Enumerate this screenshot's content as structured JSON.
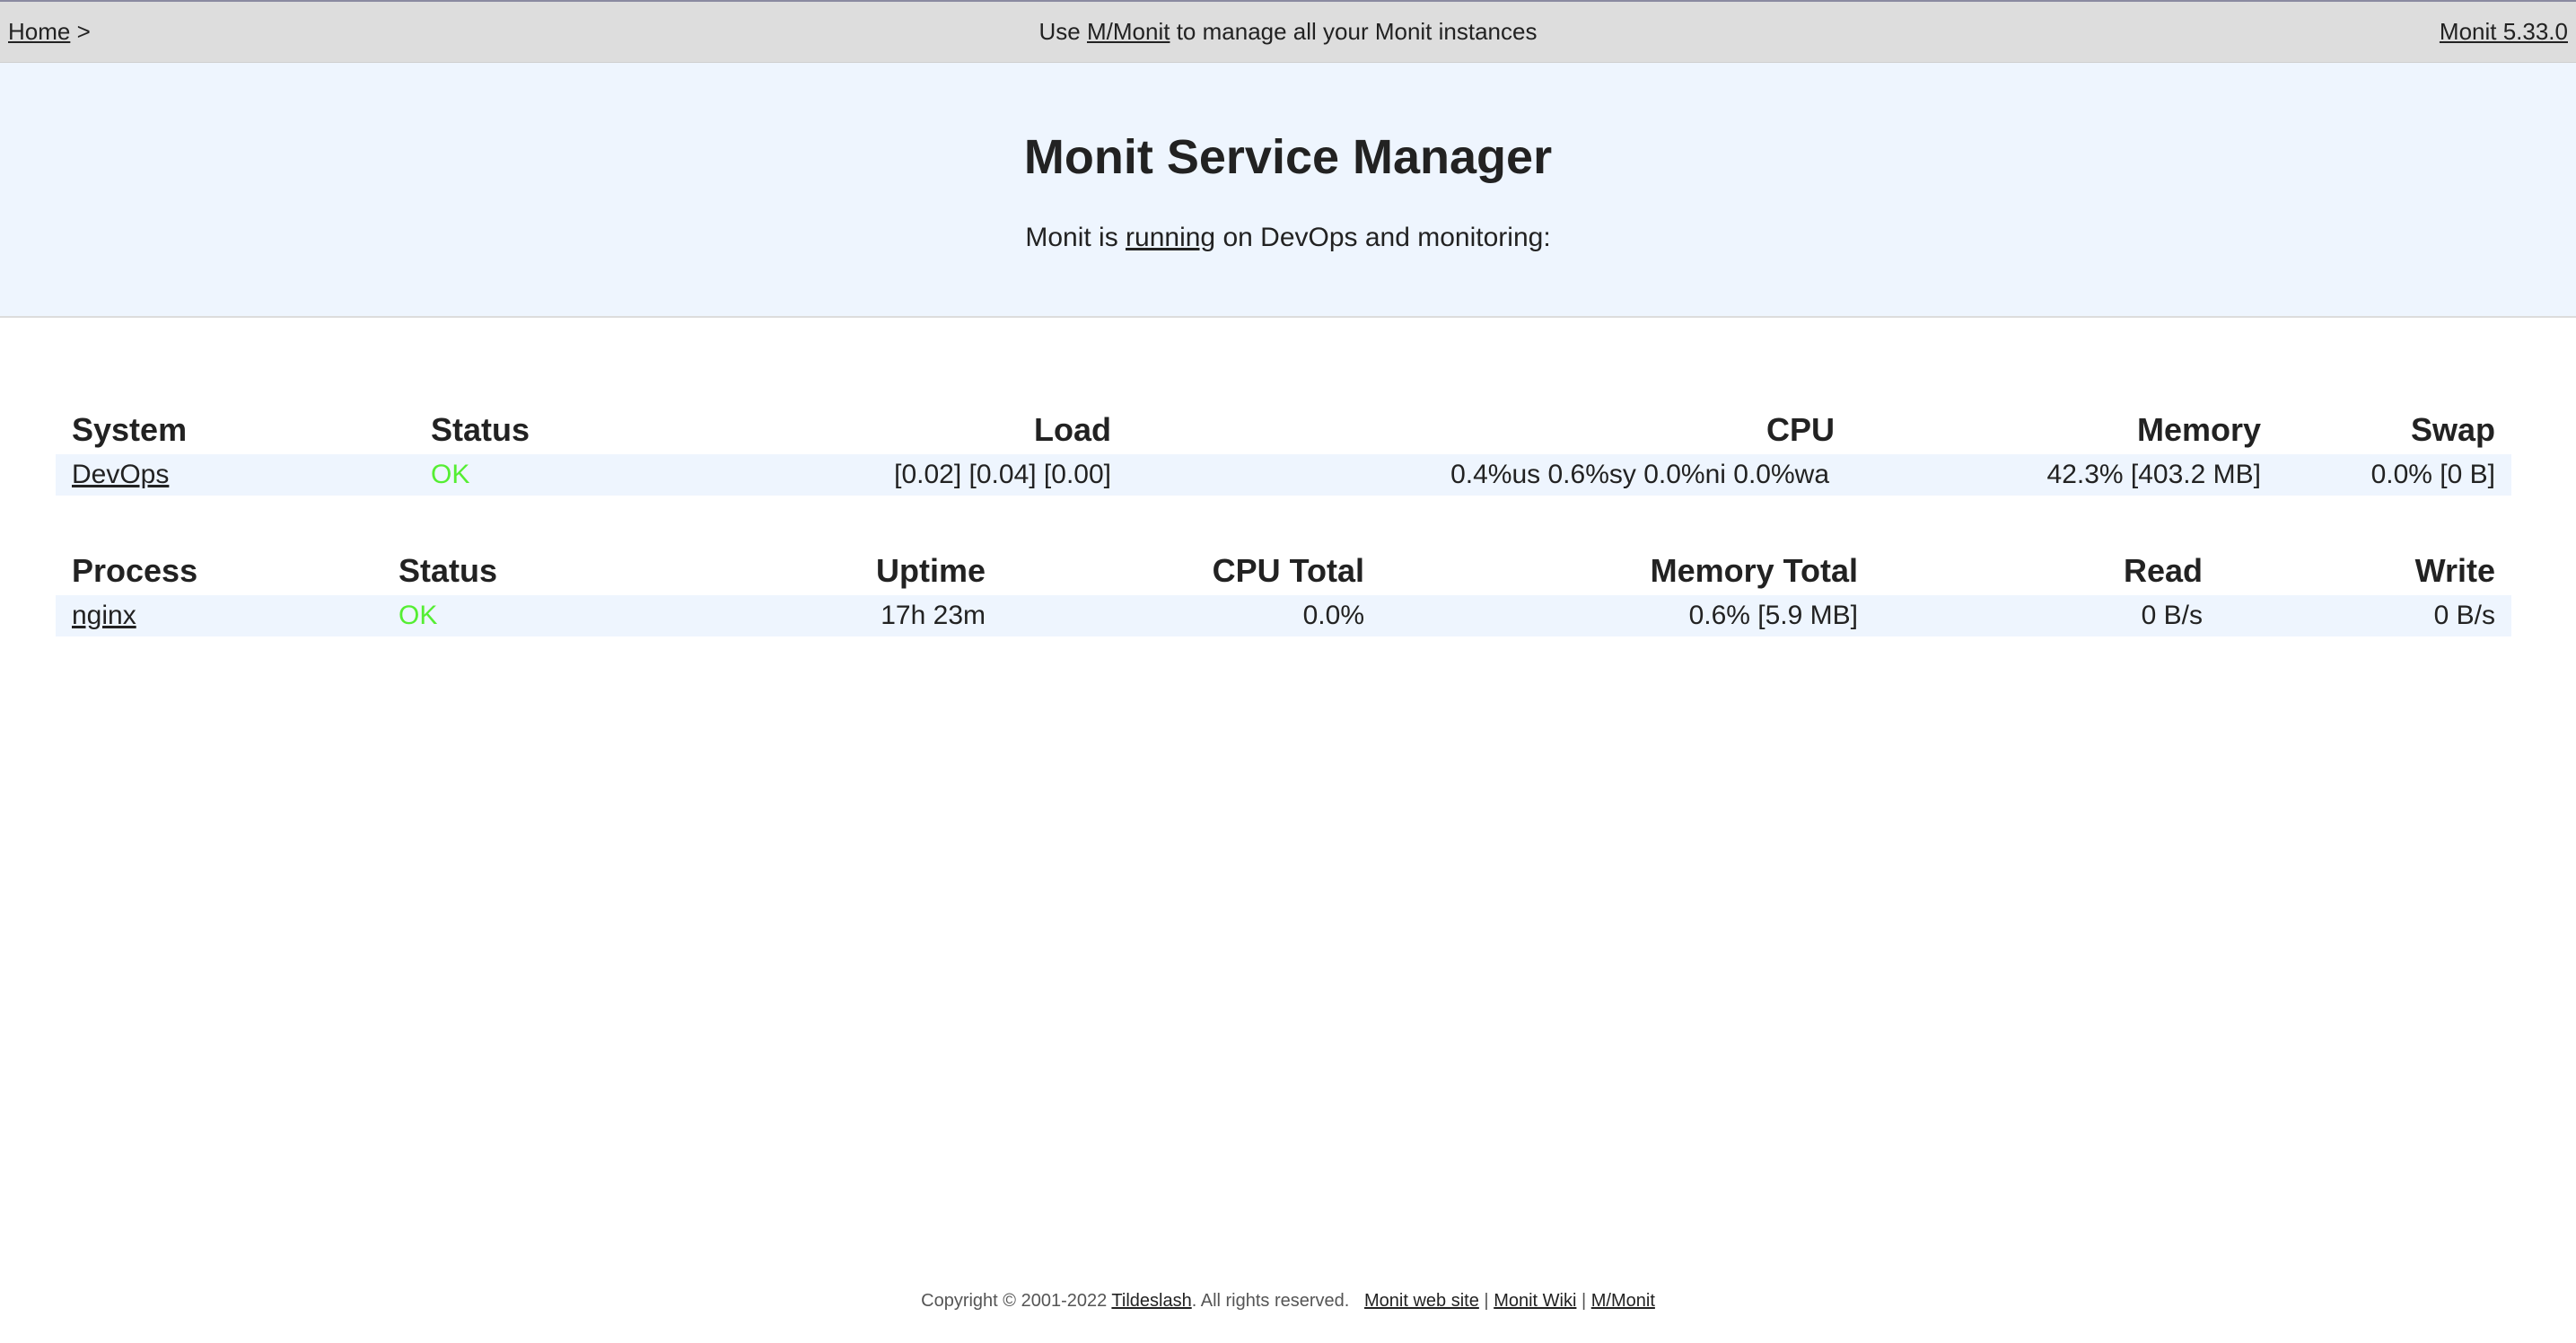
{
  "topbar": {
    "home_link": "Home",
    "separator": ">",
    "notice_prefix": "Use",
    "mmonit_link": "M/Monit",
    "notice_suffix": "to manage all your Monit instances",
    "version_link": "Monit 5.33.0"
  },
  "header": {
    "title": "Monit Service Manager",
    "status_prefix": "Monit is",
    "status_link": "running",
    "status_suffix": "on DevOps and monitoring:"
  },
  "system_table": {
    "columns": [
      "System",
      "Status",
      "Load",
      "CPU",
      "Memory",
      "Swap"
    ],
    "rows": [
      {
        "system": "DevOps",
        "status": "OK",
        "load": "[0.02] [0.04] [0.00]",
        "cpu": "0.4%us 0.6%sy 0.0%ni 0.0%wa",
        "memory": "42.3% [403.2 MB]",
        "swap": "0.0% [0 B]"
      }
    ]
  },
  "process_table": {
    "columns": [
      "Process",
      "Status",
      "Uptime",
      "CPU Total",
      "Memory Total",
      "Read",
      "Write"
    ],
    "rows": [
      {
        "process": "nginx",
        "status": "OK",
        "uptime": "17h 23m",
        "cpu_total": "0.0%",
        "memory_total": "0.6% [5.9 MB]",
        "read": "0 B/s",
        "write": "0 B/s"
      }
    ]
  },
  "footer": {
    "copyright_prefix": "Copyright © 2001-2022",
    "tildeslash_link": "Tildeslash",
    "copyright_suffix": ". All rights reserved.",
    "website_link": "Monit web site",
    "wiki_link": "Monit Wiki",
    "mmonit_link": "M/Monit",
    "divider": "|"
  },
  "colors": {
    "ok_status": "#55ee33",
    "topbar_bg": "#dddddd",
    "header_bg": "#eef5fe",
    "row_bg": "#eef5fe"
  }
}
